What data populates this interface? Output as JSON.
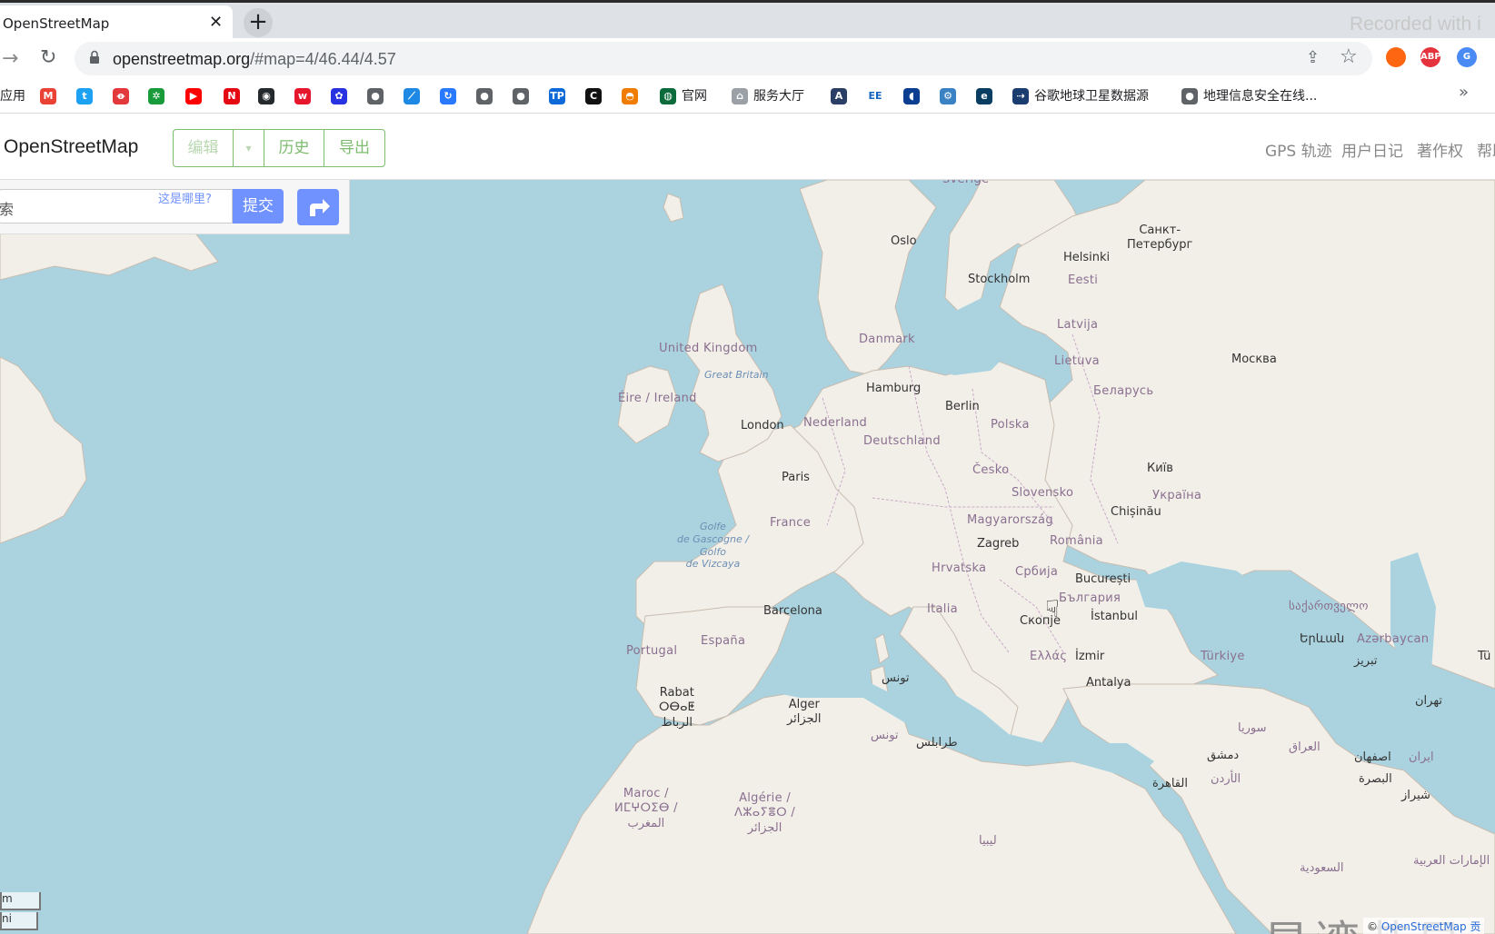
{
  "browser": {
    "tab_title": "OpenStreetMap",
    "tab_close": "✕",
    "new_tab": "+",
    "overlay_text": "Recorded with i",
    "url_host": "openstreetmap.org",
    "url_path": "/#map=4/46.44/4.57",
    "extensions": [
      {
        "name": "firefox-relay-icon",
        "color": "#ff6611",
        "text": ""
      },
      {
        "name": "adblock-plus-icon",
        "color": "#e5333d",
        "text": "ABP"
      },
      {
        "name": "google-translate-icon",
        "color": "#4a8af4",
        "text": "G"
      }
    ],
    "bookmarks": [
      {
        "name": "apps",
        "icon": "apps-icon",
        "color": "#ffffff",
        "glyph": "",
        "label": "应用"
      },
      {
        "name": "gmail",
        "icon": "gmail-icon",
        "color": "#ea4335",
        "glyph": "M",
        "label": ""
      },
      {
        "name": "twitter",
        "icon": "twitter-icon",
        "color": "#1da1f2",
        "glyph": "t",
        "label": ""
      },
      {
        "name": "red-app",
        "icon": "red-logo-icon",
        "color": "#e4393c",
        "glyph": "ꝋ",
        "label": ""
      },
      {
        "name": "green-app",
        "icon": "green-flower-icon",
        "color": "#1a9b3b",
        "glyph": "✲",
        "label": ""
      },
      {
        "name": "youtube",
        "icon": "youtube-icon",
        "color": "#ff0000",
        "glyph": "▶",
        "label": ""
      },
      {
        "name": "netflix",
        "icon": "netflix-icon",
        "color": "#e50914",
        "glyph": "N",
        "label": ""
      },
      {
        "name": "github",
        "icon": "github-icon",
        "color": "#24292e",
        "glyph": "◉",
        "label": ""
      },
      {
        "name": "weibo",
        "icon": "weibo-icon",
        "color": "#e6162d",
        "glyph": "w",
        "label": ""
      },
      {
        "name": "baidu",
        "icon": "baidu-paw-icon",
        "color": "#2932e1",
        "glyph": "✿",
        "label": ""
      },
      {
        "name": "globe-1",
        "icon": "globe-icon",
        "color": "#5f6368",
        "glyph": "●",
        "label": ""
      },
      {
        "name": "feather",
        "icon": "feather-icon",
        "color": "#1e88e5",
        "glyph": "⟋",
        "label": ""
      },
      {
        "name": "sync",
        "icon": "sync-icon",
        "color": "#2979ff",
        "glyph": "↻",
        "label": ""
      },
      {
        "name": "globe-2",
        "icon": "globe-icon",
        "color": "#5f6368",
        "glyph": "●",
        "label": ""
      },
      {
        "name": "globe-3",
        "icon": "globe-icon",
        "color": "#5f6368",
        "glyph": "●",
        "label": ""
      },
      {
        "name": "tp",
        "icon": "tp-icon",
        "color": "#0d6ad8",
        "glyph": "TP",
        "label": ""
      },
      {
        "name": "c-app",
        "icon": "c-logo-icon",
        "color": "#111111",
        "glyph": "C",
        "label": ""
      },
      {
        "name": "orange-app",
        "icon": "orange-hat-icon",
        "color": "#f07c00",
        "glyph": "◓",
        "label": ""
      },
      {
        "name": "official-site",
        "icon": "official-site-icon",
        "color": "#0b6b3a",
        "glyph": "◍",
        "label": "官网"
      },
      {
        "name": "service-hall",
        "icon": "home-icon",
        "color": "#9aa0a6",
        "glyph": "⌂",
        "label": "服务大厅"
      },
      {
        "name": "arcgis",
        "icon": "arcgis-icon",
        "color": "#2b3f66",
        "glyph": "A",
        "label": ""
      },
      {
        "name": "ee",
        "icon": "earth-engine-icon",
        "color": "#ffffff",
        "glyph": "EE",
        "label": ""
      },
      {
        "name": "nasa",
        "icon": "nasa-icon",
        "color": "#0b3d91",
        "glyph": "◖",
        "label": ""
      },
      {
        "name": "gear-app",
        "icon": "gear-icon",
        "color": "#3b82c4",
        "glyph": "⚙",
        "label": ""
      },
      {
        "name": "e-app",
        "icon": "e-logo-icon",
        "color": "#0a3d62",
        "glyph": "e",
        "label": ""
      },
      {
        "name": "google-earth",
        "icon": "satellite-icon",
        "color": "#1a3c6e",
        "glyph": "⇢",
        "label": "谷歌地球卫星数据源"
      },
      {
        "name": "geo-security",
        "icon": "globe-icon",
        "color": "#5f6368",
        "glyph": "●",
        "label": "地理信息安全在线..."
      }
    ],
    "more_bookmarks": "»"
  },
  "osm": {
    "brand": "OpenStreetMap",
    "edit_label": "编辑",
    "dropdown_label": "▾",
    "history_label": "历史",
    "export_label": "导出",
    "nav": [
      {
        "name": "nav-gps-traces",
        "label": "GPS 轨迹"
      },
      {
        "name": "nav-user-diaries",
        "label": "用户日记"
      },
      {
        "name": "nav-copyright",
        "label": "著作权"
      },
      {
        "name": "nav-help",
        "label": "帮助"
      }
    ],
    "search_placeholder": "索",
    "where_is_this": "这是哪里?",
    "submit_label": "提交"
  },
  "map": {
    "labels": [
      {
        "name": "label-sverige",
        "text": "Sverige",
        "cls": "country"
      },
      {
        "name": "label-oslo",
        "text": "Oslo",
        "cls": "city"
      },
      {
        "name": "label-stockholm",
        "text": "Stockholm",
        "cls": "city"
      },
      {
        "name": "label-helsinki",
        "text": "Helsinki",
        "cls": "city"
      },
      {
        "name": "label-spb",
        "text": "Санкт-\nПетербург",
        "cls": "city"
      },
      {
        "name": "label-eesti",
        "text": "Eesti",
        "cls": "country"
      },
      {
        "name": "label-latvija",
        "text": "Latvija",
        "cls": "country"
      },
      {
        "name": "label-lietuva",
        "text": "Lietuva",
        "cls": "country"
      },
      {
        "name": "label-moskva",
        "text": "Москва",
        "cls": "city"
      },
      {
        "name": "label-danmark",
        "text": "Danmark",
        "cls": "country"
      },
      {
        "name": "label-uk",
        "text": "United Kingdom",
        "cls": "country"
      },
      {
        "name": "label-great-britain",
        "text": "Great Britain",
        "cls": "sea"
      },
      {
        "name": "label-ireland",
        "text": "Éire / Ireland",
        "cls": "country"
      },
      {
        "name": "label-hamburg",
        "text": "Hamburg",
        "cls": "city"
      },
      {
        "name": "label-berlin",
        "text": "Berlin",
        "cls": "city"
      },
      {
        "name": "label-belarus",
        "text": "Беларусь",
        "cls": "country"
      },
      {
        "name": "label-london",
        "text": "London",
        "cls": "city"
      },
      {
        "name": "label-nederland",
        "text": "Nederland",
        "cls": "country"
      },
      {
        "name": "label-polska",
        "text": "Polska",
        "cls": "country"
      },
      {
        "name": "label-deutschland",
        "text": "Deutschland",
        "cls": "country"
      },
      {
        "name": "label-kyiv",
        "text": "Київ",
        "cls": "city"
      },
      {
        "name": "label-paris",
        "text": "Paris",
        "cls": "city"
      },
      {
        "name": "label-cesko",
        "text": "Česko",
        "cls": "country"
      },
      {
        "name": "label-slovensko",
        "text": "Slovensko",
        "cls": "country"
      },
      {
        "name": "label-ukraina",
        "text": "Україна",
        "cls": "country"
      },
      {
        "name": "label-chisinau",
        "text": "Chișinău",
        "cls": "city"
      },
      {
        "name": "label-france",
        "text": "France",
        "cls": "country"
      },
      {
        "name": "label-magyarorszag",
        "text": "Magyarország",
        "cls": "country"
      },
      {
        "name": "label-gascogne",
        "text": "Golfe\nde Gascogne /\nGolfo\nde Vizcaya",
        "cls": "sea"
      },
      {
        "name": "label-zagreb",
        "text": "Zagreb",
        "cls": "city"
      },
      {
        "name": "label-romania",
        "text": "România",
        "cls": "country"
      },
      {
        "name": "label-hrvatska",
        "text": "Hrvatska",
        "cls": "country"
      },
      {
        "name": "label-srbija",
        "text": "Србија",
        "cls": "country"
      },
      {
        "name": "label-bucuresti",
        "text": "București",
        "cls": "city"
      },
      {
        "name": "label-bulgaria",
        "text": "България",
        "cls": "country"
      },
      {
        "name": "label-georgia",
        "text": "საქართველო",
        "cls": "country"
      },
      {
        "name": "label-barcelona",
        "text": "Barcelona",
        "cls": "city"
      },
      {
        "name": "label-italia",
        "text": "Italia",
        "cls": "country"
      },
      {
        "name": "label-skopje",
        "text": "Скопје",
        "cls": "city"
      },
      {
        "name": "label-istanbul",
        "text": "İstanbul",
        "cls": "city"
      },
      {
        "name": "label-portugal",
        "text": "Portugal",
        "cls": "country"
      },
      {
        "name": "label-espana",
        "text": "España",
        "cls": "country"
      },
      {
        "name": "label-yerevan",
        "text": "Երևան",
        "cls": "city"
      },
      {
        "name": "label-azerbaycan",
        "text": "Azərbaycan",
        "cls": "country"
      },
      {
        "name": "label-ellas",
        "text": "Ελλάς",
        "cls": "country"
      },
      {
        "name": "label-izmir",
        "text": "İzmir",
        "cls": "city"
      },
      {
        "name": "label-turkiye",
        "text": "Türkiye",
        "cls": "country"
      },
      {
        "name": "label-tabriz",
        "text": "تبریز",
        "cls": "city"
      },
      {
        "name": "label-tu",
        "text": "Tü",
        "cls": "city"
      },
      {
        "name": "label-antalya",
        "text": "Antalya",
        "cls": "city"
      },
      {
        "name": "label-tunis",
        "text": "تونس",
        "cls": "city"
      },
      {
        "name": "label-rabat",
        "text": "Rabat\nⵔⴱⴰⵟ\nالرباط",
        "cls": "city"
      },
      {
        "name": "label-alger",
        "text": "Alger\nالجزائر",
        "cls": "city"
      },
      {
        "name": "label-tunisia",
        "text": "تونس",
        "cls": "country"
      },
      {
        "name": "label-tarabulus",
        "text": "طرابلس",
        "cls": "city"
      },
      {
        "name": "label-tehran",
        "text": "تهران",
        "cls": "city"
      },
      {
        "name": "label-syria",
        "text": "سوريا",
        "cls": "country"
      },
      {
        "name": "label-iraq",
        "text": "العراق",
        "cls": "country"
      },
      {
        "name": "label-damascus",
        "text": "دمشق",
        "cls": "city"
      },
      {
        "name": "label-isfahan",
        "text": "اصفهان",
        "cls": "city"
      },
      {
        "name": "label-iran",
        "text": "ایران",
        "cls": "country"
      },
      {
        "name": "label-jordan",
        "text": "الأردن",
        "cls": "country"
      },
      {
        "name": "label-cairo",
        "text": "القاهرة",
        "cls": "city"
      },
      {
        "name": "label-basra",
        "text": "البصرة",
        "cls": "city"
      },
      {
        "name": "label-shiraz",
        "text": "شيراز",
        "cls": "city"
      },
      {
        "name": "label-maroc",
        "text": "Maroc /\nⵍⵎⵖⵔⵉⴱ /\nالمغرب",
        "cls": "country"
      },
      {
        "name": "label-algerie",
        "text": "Algérie /\nⴷⵣⴰⵢⴻⵔ /\nالجزائر",
        "cls": "country"
      },
      {
        "name": "label-libya",
        "text": "ليبيا",
        "cls": "country"
      },
      {
        "name": "label-uae",
        "text": "الإمارات العربية",
        "cls": "country"
      },
      {
        "name": "label-saudi",
        "text": "السعودية",
        "cls": "country"
      }
    ],
    "watermark": "星湾芯星",
    "scale_top": "m",
    "scale_bottom": "ni",
    "attribution_prefix": "© ",
    "attribution_link": "OpenStreetMap 贡"
  }
}
